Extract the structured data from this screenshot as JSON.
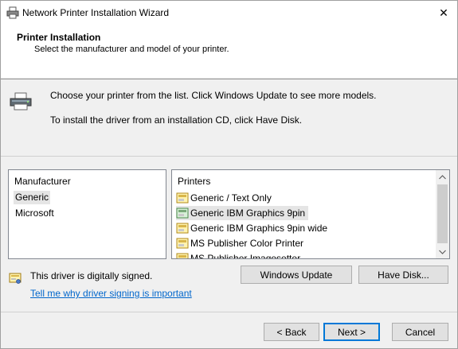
{
  "window": {
    "title": "Network Printer Installation Wizard",
    "close_glyph": "✕"
  },
  "header": {
    "title": "Printer Installation",
    "subtitle": "Select the manufacturer and model of your printer."
  },
  "intro": {
    "line1": "Choose your printer from the list. Click Windows Update to see more models.",
    "line2": "To install the driver from an installation CD, click Have Disk."
  },
  "manufacturer": {
    "header": "Manufacturer",
    "items": [
      "Generic",
      "Microsoft"
    ],
    "selected": "Generic"
  },
  "printers": {
    "header": "Printers",
    "items": [
      "Generic / Text Only",
      "Generic IBM Graphics 9pin",
      "Generic IBM Graphics 9pin wide",
      "MS Publisher Color Printer",
      "MS Publisher Imagesetter"
    ],
    "selected": "Generic IBM Graphics 9pin"
  },
  "signing": {
    "status": "This driver is digitally signed.",
    "link": "Tell me why driver signing is important"
  },
  "buttons": {
    "windows_update": "Windows Update",
    "have_disk": "Have Disk...",
    "back": "< Back",
    "next": "Next >",
    "cancel": "Cancel"
  },
  "icons": {
    "title": "printer-icon",
    "graphic": "printer-graphic-icon",
    "printer_item": "printer-item-icon",
    "signed": "certificate-icon"
  },
  "colors": {
    "link": "#0066cc",
    "default_button_border": "#0078d7",
    "selection": "#e5e5e5"
  }
}
